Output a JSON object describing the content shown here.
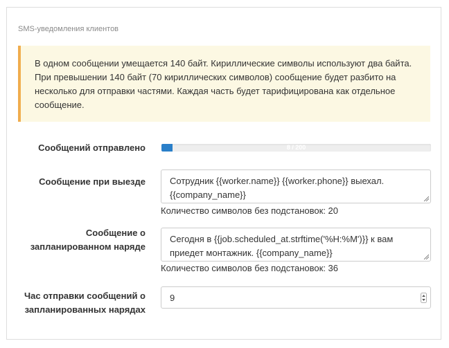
{
  "panel": {
    "title": "SMS-уведомления клиентов"
  },
  "alert": {
    "text": "В одном сообщении умещается 140 байт. Кириллические символы используют два байта. При превышении 140 байт (70 кириллических символов) сообщение будет разбито на несколько для отправки частями. Каждая часть будет тарифицирована как отдельное сообщение.",
    "border_color": "#f0ad4e",
    "background_color": "#fcf8e3"
  },
  "sent": {
    "label": "Сообщений отправлено",
    "progress_text": "8 / 200",
    "progress_fraction": 0.04,
    "bar_color": "#2a7fc9"
  },
  "departure": {
    "label": "Сообщение при выезде",
    "value": "Сотрудник {{worker.name}} {{worker.phone}} выехал. {{company_name}}",
    "hint": "Количество символов без подстановок: 20"
  },
  "scheduled": {
    "label": "Сообщение о запланированном наряде",
    "value": "Сегодня в {{job.scheduled_at.strftime('%H:%M')}} к вам приедет монтажник. {{company_name}}",
    "hint": "Количество символов без подстановок: 36"
  },
  "send_hour": {
    "label": "Час отправки сообщений о запланированных нарядах",
    "value": "9"
  }
}
